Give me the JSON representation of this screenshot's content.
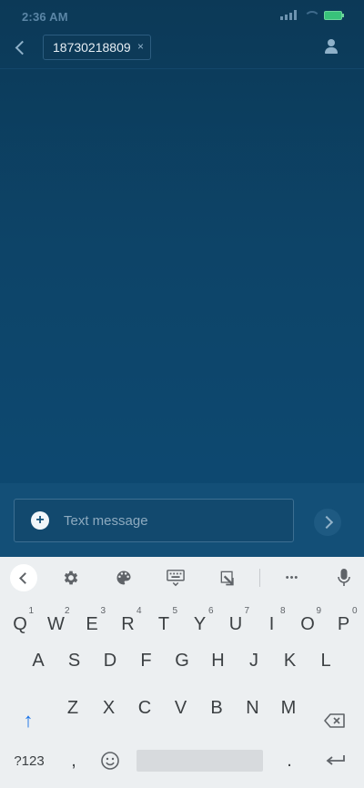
{
  "status_bar": {
    "time": "2:36 AM"
  },
  "header": {
    "recipient_number": "18730218809",
    "chip_remove": "×"
  },
  "composer": {
    "placeholder": "Text message",
    "plus": "+"
  },
  "keyboard": {
    "rows": [
      [
        {
          "k": "Q",
          "h": "1"
        },
        {
          "k": "W",
          "h": "2"
        },
        {
          "k": "E",
          "h": "3"
        },
        {
          "k": "R",
          "h": "4"
        },
        {
          "k": "T",
          "h": "5"
        },
        {
          "k": "Y",
          "h": "6"
        },
        {
          "k": "U",
          "h": "7"
        },
        {
          "k": "I",
          "h": "8"
        },
        {
          "k": "O",
          "h": "9"
        },
        {
          "k": "P",
          "h": "0"
        }
      ],
      [
        {
          "k": "A"
        },
        {
          "k": "S"
        },
        {
          "k": "D"
        },
        {
          "k": "F"
        },
        {
          "k": "G"
        },
        {
          "k": "H"
        },
        {
          "k": "J"
        },
        {
          "k": "K"
        },
        {
          "k": "L"
        }
      ],
      [
        {
          "k": "Z"
        },
        {
          "k": "X"
        },
        {
          "k": "C"
        },
        {
          "k": "V"
        },
        {
          "k": "B"
        },
        {
          "k": "N"
        },
        {
          "k": "M"
        }
      ]
    ],
    "symbols_key": "?123",
    "comma_key": ",",
    "period_key": ".",
    "shift_icon": "↑",
    "delete_icon": "⌫",
    "enter_icon": "↵",
    "emoji_icon": "☺",
    "more_icon": "•••"
  },
  "colors": {
    "app_bg": "#0d4468",
    "keyboard_bg": "#eceff1",
    "shift_accent": "#1a73e8"
  }
}
